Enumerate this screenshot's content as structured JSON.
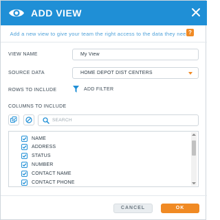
{
  "dialog": {
    "title": "ADD VIEW",
    "close_icon": "close-icon",
    "logo_icon": "eye-logo-icon",
    "description": "Add a new view to give your team the right access to the data they need.",
    "help_label": "?"
  },
  "form": {
    "view_name": {
      "label": "VIEW NAME",
      "value": "My View"
    },
    "source_data": {
      "label": "SOURCE DATA",
      "value": "HOME DEPOT DIST CENTERS"
    },
    "rows": {
      "label": "ROWS TO INCLUDE",
      "link": "ADD FILTER",
      "icon": "filter-icon"
    },
    "columns": {
      "label": "COLUMNS TO INCLUDE",
      "search_placeholder": "SEARCH",
      "items": [
        {
          "label": "NAME",
          "checked": true
        },
        {
          "label": "ADDRESS",
          "checked": true
        },
        {
          "label": "STATUS",
          "checked": true
        },
        {
          "label": "NUMBER",
          "checked": true
        },
        {
          "label": "CONTACT NAME",
          "checked": true
        },
        {
          "label": "CONTACT PHONE",
          "checked": true
        }
      ]
    }
  },
  "footer": {
    "cancel_label": "CANCEL",
    "ok_label": "OK"
  },
  "colors": {
    "header": "#1f8fd6",
    "accent": "#f08a24",
    "link": "#1f8fd6"
  }
}
